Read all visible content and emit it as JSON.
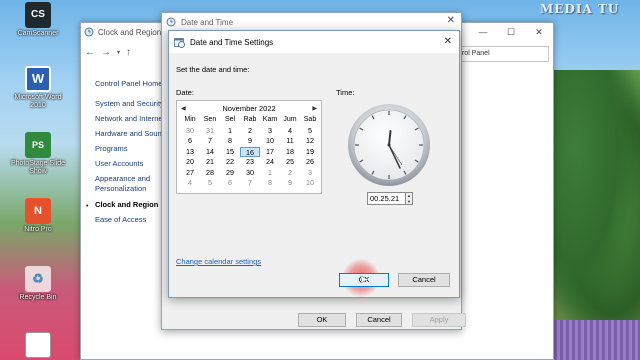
{
  "desktop": {
    "watermark": "MEDIA TU",
    "icons": [
      {
        "label": "CamScanner",
        "glyph": "CS",
        "icon": "camscanner-icon"
      },
      {
        "label": "Microsoft Word 2010",
        "glyph": "W",
        "icon": "word-icon"
      },
      {
        "label": "PhotoStage Slide Show",
        "glyph": "PS",
        "icon": "photostage-icon"
      },
      {
        "label": "Nitro Pro",
        "glyph": "N",
        "icon": "nitro-icon"
      },
      {
        "label": "Recycle Bin",
        "glyph": "♻",
        "icon": "recycle-bin-icon"
      }
    ]
  },
  "control_panel": {
    "title": "Clock and Region",
    "search_placeholder": "rol Panel",
    "nav": [
      "Control Panel Home",
      "System and Security",
      "Network and Internet",
      "Hardware and Sound",
      "Programs",
      "User Accounts",
      "Appearance and Personalization",
      "Clock and Region",
      "Ease of Access"
    ],
    "selected": "Clock and Region"
  },
  "date_time": {
    "title": "Date and Time",
    "ok": "OK",
    "cancel": "Cancel",
    "apply": "Apply"
  },
  "settings": {
    "title": "Date and Time Settings",
    "set_label": "Set the date and time:",
    "date_label": "Date:",
    "time_label": "Time:",
    "calendar": {
      "month": "November 2022",
      "weekdays": [
        "Min",
        "Sen",
        "Sel",
        "Rab",
        "Kam",
        "Jum",
        "Sab"
      ],
      "weeks": [
        [
          "30",
          "31",
          "1",
          "2",
          "3",
          "4",
          "5"
        ],
        [
          "6",
          "7",
          "8",
          "9",
          "10",
          "11",
          "12"
        ],
        [
          "13",
          "14",
          "15",
          "16",
          "17",
          "18",
          "19"
        ],
        [
          "20",
          "21",
          "22",
          "23",
          "24",
          "25",
          "26"
        ],
        [
          "27",
          "28",
          "29",
          "30",
          "1",
          "2",
          "3"
        ],
        [
          "4",
          "5",
          "6",
          "7",
          "8",
          "9",
          "10"
        ]
      ],
      "selected_day": "16"
    },
    "time_value": "00.25.21",
    "change_calendar_link": "Change calendar settings",
    "ok": "OK",
    "cancel": "Cancel"
  },
  "colors": {
    "accent": "#0078d7",
    "link": "#1a64c8"
  }
}
